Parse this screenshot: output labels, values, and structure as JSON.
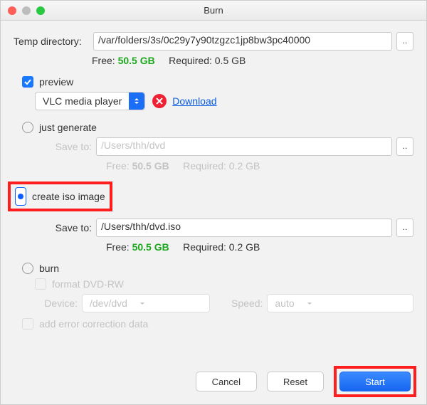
{
  "window": {
    "title": "Burn"
  },
  "temp": {
    "label": "Temp directory:",
    "path": "/var/folders/3s/0c29y7y90tzgzc1jp8bw3pc40000",
    "browse": "..",
    "free_label": "Free:",
    "free_value": "50.5 GB",
    "required_label": "Required:",
    "required_value": "0.5 GB"
  },
  "preview": {
    "label": "preview",
    "checked": true,
    "player": "VLC media player",
    "download": "Download"
  },
  "just_generate": {
    "label": "just generate",
    "save_to_label": "Save to:",
    "save_to_value": "/Users/thh/dvd",
    "browse": "..",
    "free_label": "Free:",
    "free_value": "50.5 GB",
    "required_label": "Required:",
    "required_value": "0.2 GB"
  },
  "create_iso": {
    "label": "create iso image",
    "save_to_label": "Save to:",
    "save_to_value": "/Users/thh/dvd.iso",
    "browse": "..",
    "free_label": "Free:",
    "free_value": "50.5 GB",
    "required_label": "Required:",
    "required_value": "0.2 GB"
  },
  "burn": {
    "label": "burn",
    "format_label": "format DVD-RW",
    "device_label": "Device:",
    "device_value": "/dev/dvd",
    "speed_label": "Speed:",
    "speed_value": "auto"
  },
  "ecc": {
    "label": "add error correction data"
  },
  "buttons": {
    "cancel": "Cancel",
    "reset": "Reset",
    "start": "Start"
  }
}
